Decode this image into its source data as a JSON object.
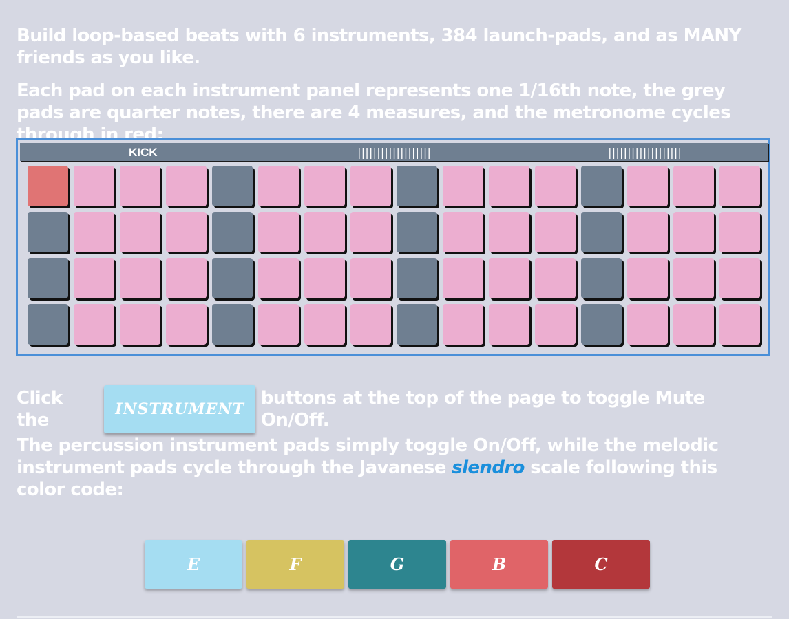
{
  "intro": {
    "line1": "Build loop-based beats with 6 instruments, 384 launch-pads, and as MANY friends as you like.",
    "line2": "Each pad on each instrument panel represents one 1/16th note, the grey pads are quarter notes, there are 4 measures, and the metronome cycles through in red:"
  },
  "panel": {
    "title": "KICK",
    "ticks_left": "|||||||||||||||||||",
    "ticks_right": "|||||||||||||||||||",
    "rows": 4,
    "cols": 16,
    "metronome_position": 0,
    "colors": {
      "pad": "#ecaed0",
      "quarter": "#6f7f91",
      "metronome": "#e07474"
    }
  },
  "mute_instructions": {
    "before": "Click the",
    "button_label": "INSTRUMENT",
    "after": "buttons at the top of the page to toggle Mute On/Off."
  },
  "melodic": {
    "text_before": "The percussion instrument pads simply toggle On/Off, while the melodic instrument pads cycle through the Javanese ",
    "link": "slendro",
    "text_after": " scale following this color code:"
  },
  "color_code": [
    {
      "label": "E",
      "color": "#a5ddf2"
    },
    {
      "label": "F",
      "color": "#d6c361"
    },
    {
      "label": "G",
      "color": "#2d858f"
    },
    {
      "label": "B",
      "color": "#e06468"
    },
    {
      "label": "C",
      "color": "#b3373b"
    }
  ]
}
